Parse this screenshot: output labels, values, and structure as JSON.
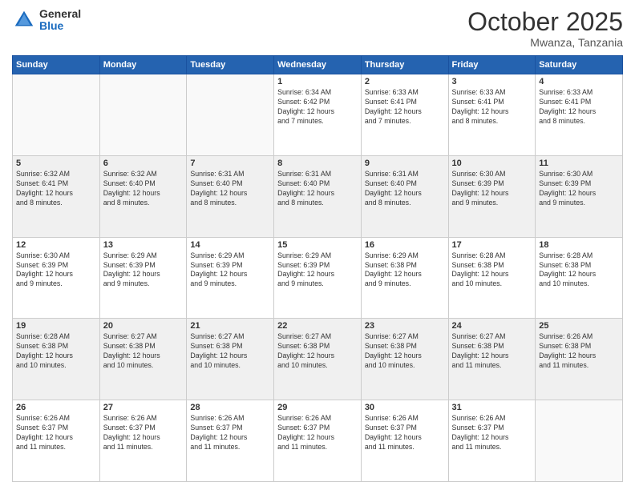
{
  "header": {
    "logo_general": "General",
    "logo_blue": "Blue",
    "month": "October 2025",
    "location": "Mwanza, Tanzania"
  },
  "days_of_week": [
    "Sunday",
    "Monday",
    "Tuesday",
    "Wednesday",
    "Thursday",
    "Friday",
    "Saturday"
  ],
  "weeks": [
    [
      {
        "day": "",
        "info": ""
      },
      {
        "day": "",
        "info": ""
      },
      {
        "day": "",
        "info": ""
      },
      {
        "day": "1",
        "info": "Sunrise: 6:34 AM\nSunset: 6:42 PM\nDaylight: 12 hours\nand 7 minutes."
      },
      {
        "day": "2",
        "info": "Sunrise: 6:33 AM\nSunset: 6:41 PM\nDaylight: 12 hours\nand 7 minutes."
      },
      {
        "day": "3",
        "info": "Sunrise: 6:33 AM\nSunset: 6:41 PM\nDaylight: 12 hours\nand 8 minutes."
      },
      {
        "day": "4",
        "info": "Sunrise: 6:33 AM\nSunset: 6:41 PM\nDaylight: 12 hours\nand 8 minutes."
      }
    ],
    [
      {
        "day": "5",
        "info": "Sunrise: 6:32 AM\nSunset: 6:41 PM\nDaylight: 12 hours\nand 8 minutes."
      },
      {
        "day": "6",
        "info": "Sunrise: 6:32 AM\nSunset: 6:40 PM\nDaylight: 12 hours\nand 8 minutes."
      },
      {
        "day": "7",
        "info": "Sunrise: 6:31 AM\nSunset: 6:40 PM\nDaylight: 12 hours\nand 8 minutes."
      },
      {
        "day": "8",
        "info": "Sunrise: 6:31 AM\nSunset: 6:40 PM\nDaylight: 12 hours\nand 8 minutes."
      },
      {
        "day": "9",
        "info": "Sunrise: 6:31 AM\nSunset: 6:40 PM\nDaylight: 12 hours\nand 8 minutes."
      },
      {
        "day": "10",
        "info": "Sunrise: 6:30 AM\nSunset: 6:39 PM\nDaylight: 12 hours\nand 9 minutes."
      },
      {
        "day": "11",
        "info": "Sunrise: 6:30 AM\nSunset: 6:39 PM\nDaylight: 12 hours\nand 9 minutes."
      }
    ],
    [
      {
        "day": "12",
        "info": "Sunrise: 6:30 AM\nSunset: 6:39 PM\nDaylight: 12 hours\nand 9 minutes."
      },
      {
        "day": "13",
        "info": "Sunrise: 6:29 AM\nSunset: 6:39 PM\nDaylight: 12 hours\nand 9 minutes."
      },
      {
        "day": "14",
        "info": "Sunrise: 6:29 AM\nSunset: 6:39 PM\nDaylight: 12 hours\nand 9 minutes."
      },
      {
        "day": "15",
        "info": "Sunrise: 6:29 AM\nSunset: 6:39 PM\nDaylight: 12 hours\nand 9 minutes."
      },
      {
        "day": "16",
        "info": "Sunrise: 6:29 AM\nSunset: 6:38 PM\nDaylight: 12 hours\nand 9 minutes."
      },
      {
        "day": "17",
        "info": "Sunrise: 6:28 AM\nSunset: 6:38 PM\nDaylight: 12 hours\nand 10 minutes."
      },
      {
        "day": "18",
        "info": "Sunrise: 6:28 AM\nSunset: 6:38 PM\nDaylight: 12 hours\nand 10 minutes."
      }
    ],
    [
      {
        "day": "19",
        "info": "Sunrise: 6:28 AM\nSunset: 6:38 PM\nDaylight: 12 hours\nand 10 minutes."
      },
      {
        "day": "20",
        "info": "Sunrise: 6:27 AM\nSunset: 6:38 PM\nDaylight: 12 hours\nand 10 minutes."
      },
      {
        "day": "21",
        "info": "Sunrise: 6:27 AM\nSunset: 6:38 PM\nDaylight: 12 hours\nand 10 minutes."
      },
      {
        "day": "22",
        "info": "Sunrise: 6:27 AM\nSunset: 6:38 PM\nDaylight: 12 hours\nand 10 minutes."
      },
      {
        "day": "23",
        "info": "Sunrise: 6:27 AM\nSunset: 6:38 PM\nDaylight: 12 hours\nand 10 minutes."
      },
      {
        "day": "24",
        "info": "Sunrise: 6:27 AM\nSunset: 6:38 PM\nDaylight: 12 hours\nand 11 minutes."
      },
      {
        "day": "25",
        "info": "Sunrise: 6:26 AM\nSunset: 6:38 PM\nDaylight: 12 hours\nand 11 minutes."
      }
    ],
    [
      {
        "day": "26",
        "info": "Sunrise: 6:26 AM\nSunset: 6:37 PM\nDaylight: 12 hours\nand 11 minutes."
      },
      {
        "day": "27",
        "info": "Sunrise: 6:26 AM\nSunset: 6:37 PM\nDaylight: 12 hours\nand 11 minutes."
      },
      {
        "day": "28",
        "info": "Sunrise: 6:26 AM\nSunset: 6:37 PM\nDaylight: 12 hours\nand 11 minutes."
      },
      {
        "day": "29",
        "info": "Sunrise: 6:26 AM\nSunset: 6:37 PM\nDaylight: 12 hours\nand 11 minutes."
      },
      {
        "day": "30",
        "info": "Sunrise: 6:26 AM\nSunset: 6:37 PM\nDaylight: 12 hours\nand 11 minutes."
      },
      {
        "day": "31",
        "info": "Sunrise: 6:26 AM\nSunset: 6:37 PM\nDaylight: 12 hours\nand 11 minutes."
      },
      {
        "day": "",
        "info": ""
      }
    ]
  ]
}
